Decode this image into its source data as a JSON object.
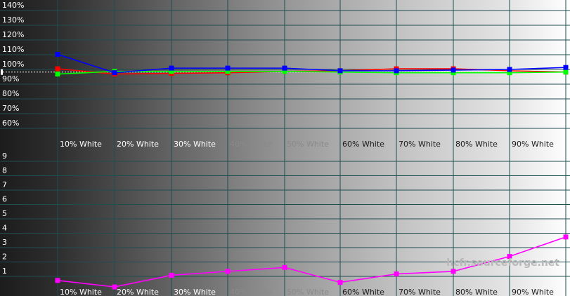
{
  "chart_data": [
    {
      "type": "line",
      "categories": [
        "",
        "10% White",
        "20% White",
        "30% White",
        "40% White",
        "50% White",
        "60% White",
        "70% White",
        "80% White",
        "90% White",
        ""
      ],
      "y_ticks": [
        "60%",
        "70%",
        "80%",
        "90%",
        "100%",
        "110%",
        "120%",
        "130%",
        "140%"
      ],
      "ylim": [
        55,
        145
      ],
      "reference_line": 98,
      "series": [
        {
          "color": "#ff0000",
          "values": [
            null,
            100.5,
            96.5,
            97,
            97.5,
            98.5,
            99,
            100.5,
            100.5,
            99,
            98
          ]
        },
        {
          "color": "#00ff00",
          "values": [
            null,
            96.5,
            98.5,
            98.5,
            98.5,
            98.5,
            98,
            97.5,
            97.5,
            97.5,
            98
          ]
        },
        {
          "color": "#0000ff",
          "values": [
            null,
            111.5,
            97.5,
            101,
            101,
            101,
            99,
            99,
            99.5,
            100,
            101.5
          ]
        }
      ]
    },
    {
      "type": "line",
      "categories": [
        "",
        "10% White",
        "20% White",
        "30% White",
        "40% White",
        "50% White",
        "60% White",
        "70% White",
        "80% White",
        "90% White",
        ""
      ],
      "y_ticks": [
        "1",
        "2",
        "3",
        "4",
        "5",
        "6",
        "7",
        "8",
        "9"
      ],
      "ylim": [
        0,
        10
      ],
      "series": [
        {
          "color": "#ff00ff",
          "values": [
            null,
            0.55,
            0.05,
            0.95,
            1.25,
            1.55,
            0.4,
            1.05,
            1.25,
            2.4,
            3.9
          ]
        }
      ]
    }
  ],
  "watermark": "hcfr.sourceforge.net",
  "colors": {
    "background_dark": "#1e1e1e",
    "background_light": "#ffffff",
    "grid": "#1f4e52",
    "reference": "#ffffff"
  }
}
